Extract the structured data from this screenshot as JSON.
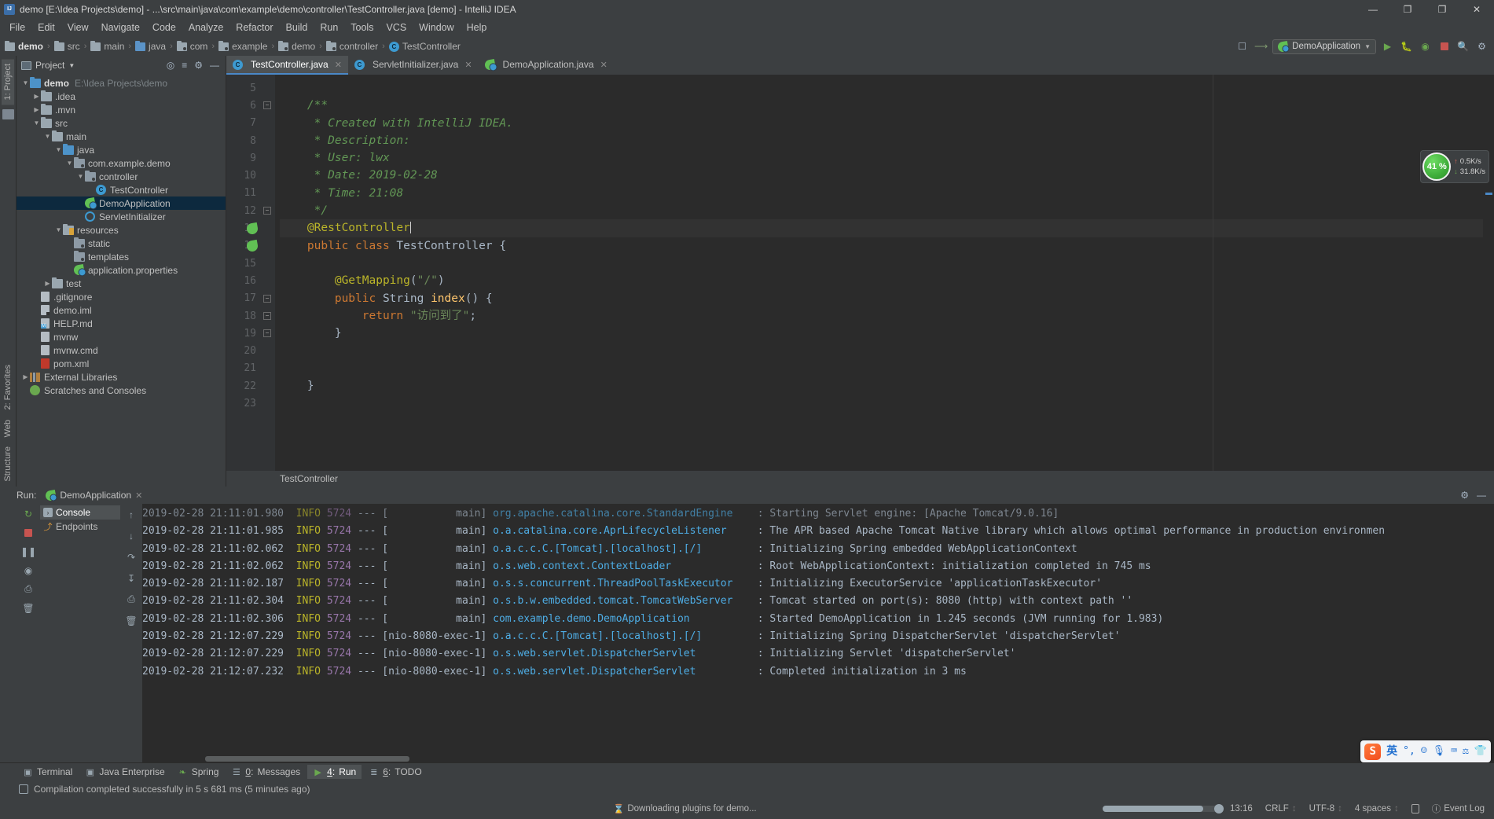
{
  "window": {
    "title": "demo [E:\\Idea Projects\\demo] - ...\\src\\main\\java\\com\\example\\demo\\controller\\TestController.java [demo] - IntelliJ IDEA",
    "minimize": "—",
    "maximize": "❐",
    "restore": "❐",
    "close": "✕"
  },
  "menubar": {
    "items": [
      "File",
      "Edit",
      "View",
      "Navigate",
      "Code",
      "Analyze",
      "Refactor",
      "Build",
      "Run",
      "Tools",
      "VCS",
      "Window",
      "Help"
    ]
  },
  "breadcrumbs": [
    {
      "label": "demo",
      "icon": "module-folder-icon",
      "bold": true
    },
    {
      "label": "src",
      "icon": "folder-icon",
      "bold": false
    },
    {
      "label": "main",
      "icon": "folder-icon",
      "bold": false
    },
    {
      "label": "java",
      "icon": "source-root-folder-icon",
      "bold": false
    },
    {
      "label": "com",
      "icon": "package-folder-icon",
      "bold": false
    },
    {
      "label": "example",
      "icon": "package-folder-icon",
      "bold": false
    },
    {
      "label": "demo",
      "icon": "package-folder-icon",
      "bold": false
    },
    {
      "label": "controller",
      "icon": "package-folder-icon",
      "bold": false
    },
    {
      "label": "TestController",
      "icon": "java-class-icon",
      "bold": false
    }
  ],
  "toolbar_right": {
    "run_configuration": "DemoApplication",
    "dropdown_caret": "▼",
    "run_label": "Run",
    "debug_label": "Debug",
    "run_coverage_label": "Run with Coverage",
    "stop_label": "Stop",
    "search_label": "Search Everywhere"
  },
  "project_panel": {
    "title": "Project",
    "caret": "▼",
    "locate_label": "Select Opened File",
    "collapse_label": "Collapse All",
    "vtab": "1: Project",
    "tree": [
      {
        "depth": 0,
        "twist": "▼",
        "icon": "module-folder-icon",
        "label": "demo",
        "bold": true,
        "path": "E:\\Idea Projects\\demo"
      },
      {
        "depth": 1,
        "twist": "▶",
        "icon": "folder-icon",
        "label": ".idea",
        "bold": false,
        "path": ""
      },
      {
        "depth": 1,
        "twist": "▶",
        "icon": "folder-icon",
        "label": ".mvn",
        "bold": false,
        "path": ""
      },
      {
        "depth": 1,
        "twist": "▼",
        "icon": "folder-icon",
        "label": "src",
        "bold": false,
        "path": ""
      },
      {
        "depth": 2,
        "twist": "▼",
        "icon": "folder-icon",
        "label": "main",
        "bold": false,
        "path": ""
      },
      {
        "depth": 3,
        "twist": "▼",
        "icon": "source-root-folder-icon",
        "label": "java",
        "bold": false,
        "path": ""
      },
      {
        "depth": 4,
        "twist": "▼",
        "icon": "package-folder-icon",
        "label": "com.example.demo",
        "bold": false,
        "path": ""
      },
      {
        "depth": 5,
        "twist": "▼",
        "icon": "package-folder-icon",
        "label": "controller",
        "bold": false,
        "path": ""
      },
      {
        "depth": 6,
        "twist": "",
        "icon": "java-class-icon",
        "label": "TestController",
        "bold": false,
        "path": ""
      },
      {
        "depth": 5,
        "twist": "",
        "icon": "spring-boot-app-icon",
        "label": "DemoApplication",
        "bold": false,
        "path": "",
        "selected": true
      },
      {
        "depth": 5,
        "twist": "",
        "icon": "java-interface-icon",
        "label": "ServletInitializer",
        "bold": false,
        "path": ""
      },
      {
        "depth": 3,
        "twist": "▼",
        "icon": "resources-folder-icon",
        "label": "resources",
        "bold": false,
        "path": ""
      },
      {
        "depth": 4,
        "twist": "",
        "icon": "package-folder-icon",
        "label": "static",
        "bold": false,
        "path": ""
      },
      {
        "depth": 4,
        "twist": "",
        "icon": "package-folder-icon",
        "label": "templates",
        "bold": false,
        "path": ""
      },
      {
        "depth": 4,
        "twist": "",
        "icon": "spring-properties-icon",
        "label": "application.properties",
        "bold": false,
        "path": ""
      },
      {
        "depth": 2,
        "twist": "▶",
        "icon": "folder-icon",
        "label": "test",
        "bold": false,
        "path": ""
      },
      {
        "depth": 1,
        "twist": "",
        "icon": "file-icon",
        "label": ".gitignore",
        "bold": false,
        "path": ""
      },
      {
        "depth": 1,
        "twist": "",
        "icon": "iml-file-icon",
        "label": "demo.iml",
        "bold": false,
        "path": ""
      },
      {
        "depth": 1,
        "twist": "",
        "icon": "markdown-file-icon",
        "label": "HELP.md",
        "bold": false,
        "path": ""
      },
      {
        "depth": 1,
        "twist": "",
        "icon": "file-icon",
        "label": "mvnw",
        "bold": false,
        "path": ""
      },
      {
        "depth": 1,
        "twist": "",
        "icon": "file-icon",
        "label": "mvnw.cmd",
        "bold": false,
        "path": ""
      },
      {
        "depth": 1,
        "twist": "",
        "icon": "maven-pom-icon",
        "label": "pom.xml",
        "bold": false,
        "path": ""
      },
      {
        "depth": 0,
        "twist": "▶",
        "icon": "external-libraries-icon",
        "label": "External Libraries",
        "bold": false,
        "path": ""
      },
      {
        "depth": 0,
        "twist": "",
        "icon": "scratches-icon",
        "label": "Scratches and Consoles",
        "bold": false,
        "path": ""
      }
    ]
  },
  "editor": {
    "tabs": [
      {
        "label": "TestController.java",
        "icon": "java-class-icon",
        "active": true,
        "close": "✕"
      },
      {
        "label": "ServletInitializer.java",
        "icon": "java-class-icon",
        "active": false,
        "close": "✕"
      },
      {
        "label": "DemoApplication.java",
        "icon": "spring-boot-app-icon",
        "active": false,
        "close": "✕"
      }
    ],
    "first_line_number": 5,
    "lines": [
      {
        "n": 5,
        "fold": "",
        "gmark": "",
        "tokens": []
      },
      {
        "n": 6,
        "fold": "-",
        "gmark": "",
        "tokens": [
          {
            "t": "comment",
            "v": "    /**"
          }
        ]
      },
      {
        "n": 7,
        "fold": "",
        "gmark": "",
        "tokens": [
          {
            "t": "comment",
            "v": "     * Created with IntelliJ IDEA."
          }
        ]
      },
      {
        "n": 8,
        "fold": "",
        "gmark": "",
        "tokens": [
          {
            "t": "comment",
            "v": "     * Description:"
          }
        ]
      },
      {
        "n": 9,
        "fold": "",
        "gmark": "",
        "tokens": [
          {
            "t": "comment",
            "v": "     * User: lwx"
          }
        ]
      },
      {
        "n": 10,
        "fold": "",
        "gmark": "",
        "tokens": [
          {
            "t": "comment",
            "v": "     * Date: 2019-02-28"
          }
        ]
      },
      {
        "n": 11,
        "fold": "",
        "gmark": "",
        "tokens": [
          {
            "t": "comment",
            "v": "     * Time: 21:08"
          }
        ]
      },
      {
        "n": 12,
        "fold": "-",
        "gmark": "",
        "tokens": [
          {
            "t": "comment",
            "v": "     */"
          }
        ]
      },
      {
        "n": 13,
        "fold": "",
        "gmark": "spring-bean-icon",
        "caret": true,
        "tokens": [
          {
            "t": "annot",
            "v": "    @RestController"
          }
        ]
      },
      {
        "n": 14,
        "fold": "",
        "gmark": "spring-class-icon",
        "tokens": [
          {
            "t": "kw",
            "v": "    public class "
          },
          {
            "t": "plain",
            "v": "TestController {"
          }
        ]
      },
      {
        "n": 15,
        "fold": "",
        "gmark": "",
        "tokens": []
      },
      {
        "n": 16,
        "fold": "",
        "gmark": "",
        "tokens": [
          {
            "t": "annot",
            "v": "        @GetMapping"
          },
          {
            "t": "plain",
            "v": "("
          },
          {
            "t": "str",
            "v": "\"/\""
          },
          {
            "t": "plain",
            "v": ")"
          }
        ]
      },
      {
        "n": 17,
        "fold": "-",
        "gmark": "",
        "tokens": [
          {
            "t": "kw",
            "v": "        public "
          },
          {
            "t": "plain",
            "v": "String "
          },
          {
            "t": "method",
            "v": "index"
          },
          {
            "t": "plain",
            "v": "() {"
          }
        ]
      },
      {
        "n": 18,
        "fold": "-",
        "gmark": "",
        "tokens": [
          {
            "t": "kw",
            "v": "            return "
          },
          {
            "t": "str",
            "v": "\"访问到了\""
          },
          {
            "t": "plain",
            "v": ";"
          }
        ]
      },
      {
        "n": 19,
        "fold": "-",
        "gmark": "",
        "tokens": [
          {
            "t": "plain",
            "v": "        }"
          }
        ]
      },
      {
        "n": 20,
        "fold": "",
        "gmark": "",
        "tokens": []
      },
      {
        "n": 21,
        "fold": "",
        "gmark": "",
        "tokens": []
      },
      {
        "n": 22,
        "fold": "",
        "gmark": "",
        "tokens": [
          {
            "t": "plain",
            "v": "    }"
          }
        ]
      },
      {
        "n": 23,
        "fold": "",
        "gmark": "",
        "tokens": []
      }
    ],
    "breadcrumb": "TestController"
  },
  "cpu_widget": {
    "percent": "41 %",
    "upload": "0.5K/s",
    "download": "31.8K/s",
    "up_arrow": "↑",
    "down_arrow": "↓"
  },
  "run_panel": {
    "label": "Run:",
    "config_name": "DemoApplication",
    "close": "✕",
    "settings_icon": "gear-icon",
    "hide_icon": "minimize-icon",
    "vtab_favorites": "2: Favorites",
    "vtab_web": "Web",
    "vtab_structure": "Structure",
    "subtabs": [
      {
        "label": "Console",
        "icon": "console-icon",
        "active": true
      },
      {
        "label": "Endpoints",
        "icon": "endpoints-icon",
        "active": false
      }
    ],
    "console_lines": [
      {
        "ts": "2019-02-28 21:11:01.980",
        "lvl": "INFO",
        "pid": "5724",
        "thread": "main",
        "logger": "org.apache.catalina.core.StandardEngine",
        "msg": "Starting Servlet engine: [Apache Tomcat/9.0.16]",
        "clipped": true
      },
      {
        "ts": "2019-02-28 21:11:01.985",
        "lvl": "INFO",
        "pid": "5724",
        "thread": "main",
        "logger": "o.a.catalina.core.AprLifecycleListener",
        "msg": "The APR based Apache Tomcat Native library which allows optimal performance in production environmen"
      },
      {
        "ts": "2019-02-28 21:11:02.062",
        "lvl": "INFO",
        "pid": "5724",
        "thread": "main",
        "logger": "o.a.c.c.C.[Tomcat].[localhost].[/]",
        "msg": "Initializing Spring embedded WebApplicationContext"
      },
      {
        "ts": "2019-02-28 21:11:02.062",
        "lvl": "INFO",
        "pid": "5724",
        "thread": "main",
        "logger": "o.s.web.context.ContextLoader",
        "msg": "Root WebApplicationContext: initialization completed in 745 ms"
      },
      {
        "ts": "2019-02-28 21:11:02.187",
        "lvl": "INFO",
        "pid": "5724",
        "thread": "main",
        "logger": "o.s.s.concurrent.ThreadPoolTaskExecutor",
        "msg": "Initializing ExecutorService 'applicationTaskExecutor'"
      },
      {
        "ts": "2019-02-28 21:11:02.304",
        "lvl": "INFO",
        "pid": "5724",
        "thread": "main",
        "logger": "o.s.b.w.embedded.tomcat.TomcatWebServer",
        "msg": "Tomcat started on port(s): 8080 (http) with context path ''"
      },
      {
        "ts": "2019-02-28 21:11:02.306",
        "lvl": "INFO",
        "pid": "5724",
        "thread": "main",
        "logger": "com.example.demo.DemoApplication",
        "msg": "Started DemoApplication in 1.245 seconds (JVM running for 1.983)"
      },
      {
        "ts": "2019-02-28 21:12:07.229",
        "lvl": "INFO",
        "pid": "5724",
        "thread": "nio-8080-exec-1",
        "logger": "o.a.c.c.C.[Tomcat].[localhost].[/]",
        "msg": "Initializing Spring DispatcherServlet 'dispatcherServlet'"
      },
      {
        "ts": "2019-02-28 21:12:07.229",
        "lvl": "INFO",
        "pid": "5724",
        "thread": "nio-8080-exec-1",
        "logger": "o.s.web.servlet.DispatcherServlet",
        "msg": "Initializing Servlet 'dispatcherServlet'"
      },
      {
        "ts": "2019-02-28 21:12:07.232",
        "lvl": "INFO",
        "pid": "5724",
        "thread": "nio-8080-exec-1",
        "logger": "o.s.web.servlet.DispatcherServlet",
        "msg": "Completed initialization in 3 ms"
      }
    ]
  },
  "ime_bar": {
    "logo": "S",
    "mode": "英",
    "punctuation": "°,",
    "emoji": "☺",
    "voice": "🎙",
    "keyboard": "⌨",
    "screenshot": "screenshot-icon",
    "skin": "skin-icon"
  },
  "toolwindow_bar": {
    "items": [
      {
        "label": "Terminal",
        "icon": "terminal-icon",
        "num": "",
        "active": false
      },
      {
        "label": "Java Enterprise",
        "icon": "java-enterprise-icon",
        "num": "",
        "active": false
      },
      {
        "label": "Spring",
        "icon": "spring-icon",
        "num": "",
        "active": false
      },
      {
        "label": "Messages",
        "icon": "messages-icon",
        "num": "0:",
        "active": false
      },
      {
        "label": "Run",
        "icon": "run-icon",
        "num": "4:",
        "active": true
      },
      {
        "label": "TODO",
        "icon": "todo-icon",
        "num": "6:",
        "active": false
      }
    ]
  },
  "message_bar": {
    "text": "Compilation completed successfully in 5 s 681 ms (5 minutes ago)",
    "icon": "build-icon"
  },
  "statusbar": {
    "background_task": "Downloading plugins for demo...",
    "caret_position": "13:16",
    "line_separator": "CRLF",
    "encoding": "UTF-8",
    "indent": "4 spaces",
    "event_log": "Event Log",
    "sep": "↕",
    "lock_icon": "write-mode-icon"
  },
  "colors": {
    "accent_blue": "#4a88c7",
    "selection_blue": "#0d293e",
    "editor_bg": "#2b2b2b",
    "chrome_bg": "#3c3f41",
    "comment_green": "#629755",
    "annotation_yellow": "#bbb529",
    "keyword_orange": "#cc7832",
    "string_green": "#6a8759",
    "logger_cyan": "#4eade5",
    "level_yellow": "#bbb529",
    "pid_purple": "#9876aa",
    "cpu_green": "#3fae3a"
  }
}
